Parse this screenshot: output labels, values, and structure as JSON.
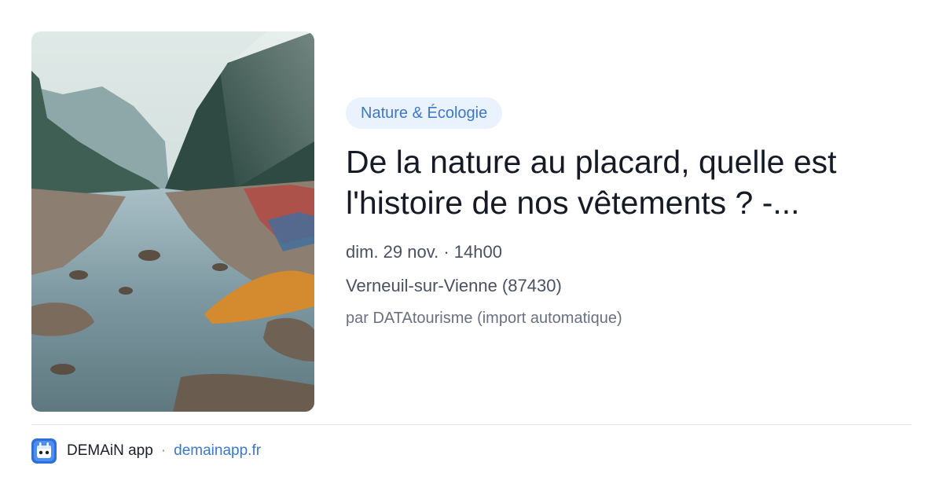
{
  "image": {
    "alt": "Rivière jonchée de vêtements abandonnés dans une vallée forestière"
  },
  "event": {
    "category": "Nature & Écologie",
    "title": "De la nature au placard, quelle est l'histoire de nos vêtements ? -...",
    "date": "dim. 29 nov. · 14h00",
    "location": "Verneuil-sur-Vienne (87430)",
    "author": "par DATAtourisme (import automatique)"
  },
  "footer": {
    "app_name": "DEMAiN app",
    "separator": "·",
    "domain": "demainapp.fr"
  },
  "colors": {
    "accent": "#3d78c8",
    "badge_bg": "#eaf2fd",
    "text_primary": "#151a25",
    "text_secondary": "#4a5160"
  }
}
